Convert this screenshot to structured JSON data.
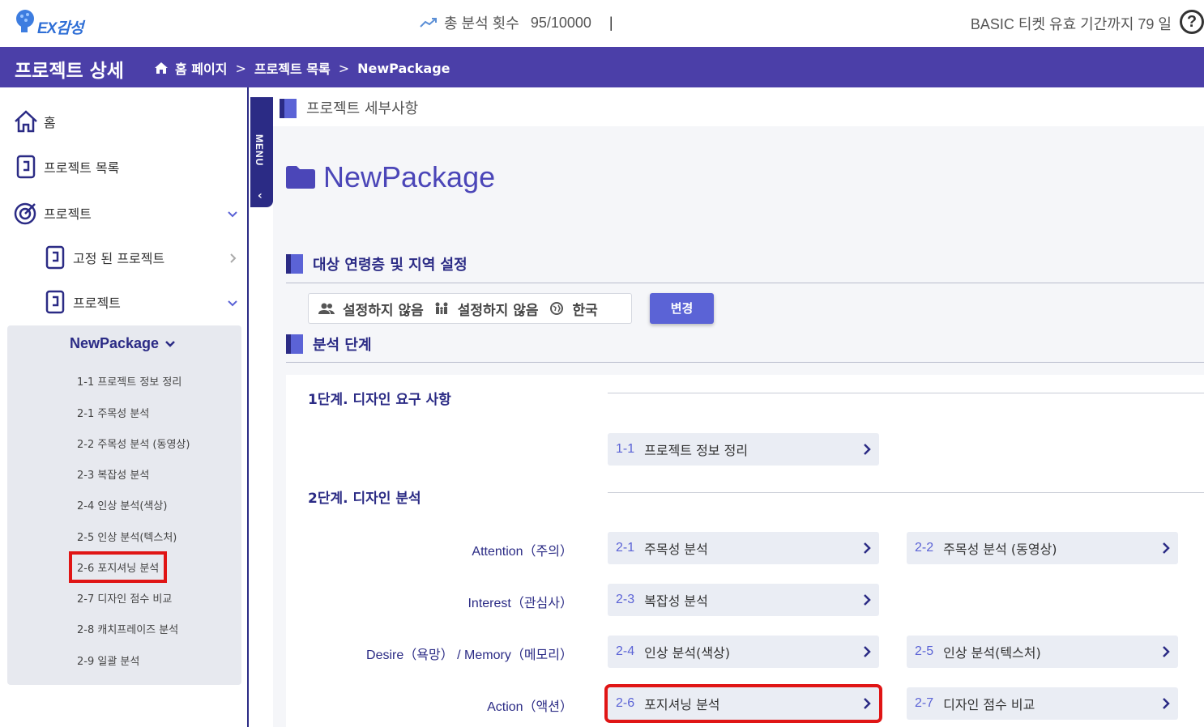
{
  "topbar": {
    "logo_text": "EX감성",
    "stats_label": "총 분석 횟수",
    "stats_value": "95/10000",
    "stats_sep": "|",
    "ticket_text": "BASIC 티켓 유효 기간까지 79 일",
    "help_label": "?"
  },
  "header": {
    "title": "프로젝트 상세",
    "breadcrumb": [
      "홈 페이지",
      "프로젝트 목록",
      "NewPackage"
    ],
    "separator": ">"
  },
  "sidebar": {
    "home": "홈",
    "project_list": "프로젝트 목록",
    "project": "프로젝트",
    "fixed_projects": "고정 된 프로젝트",
    "project_sub": "프로젝트",
    "package": "NewPackage",
    "links": [
      "1-1 프로젝트 정보 정리",
      "2-1 주목성 분석",
      "2-2 주목성 분석 (동영상)",
      "2-3 복잡성 분석",
      "2-4 인상 분석(색상)",
      "2-5 인상 분석(텍스처)",
      "2-6 포지셔닝 분석",
      "2-7 디자인 점수 비교",
      "2-8 캐치프레이즈 분석",
      "2-9 일괄 분석"
    ],
    "highlighted_link": "2-6 포지셔닝 분석"
  },
  "menu_tab": {
    "label": "MENU",
    "collapse": "‹"
  },
  "main": {
    "section_title": "프로젝트 세부사항",
    "project_name": "NewPackage",
    "target_title": "대상 연령층 및 지역 설정",
    "target": {
      "gender": "설정하지 않음",
      "age": "설정하지 않음",
      "region": "한국"
    },
    "change_button": "변경",
    "analysis_title": "분석 단계",
    "stage1_title": "1단계. 디자인 요구 사항",
    "stage2_title": "2단계. 디자인 분석",
    "rows": {
      "attention": "Attention（주의）",
      "interest": "Interest（관심사）",
      "desire": "Desire（욕망） / Memory（메모리）",
      "action": "Action（액션）"
    },
    "steps": {
      "s11": {
        "code": "1-1",
        "label": "프로젝트 정보 정리"
      },
      "s21": {
        "code": "2-1",
        "label": "주목성 분석"
      },
      "s22": {
        "code": "2-2",
        "label": "주목성 분석 (동영상)"
      },
      "s23": {
        "code": "2-3",
        "label": "복잡성 분석"
      },
      "s24": {
        "code": "2-4",
        "label": "인상 분석(색상)"
      },
      "s25": {
        "code": "2-5",
        "label": "인상 분석(텍스처)"
      },
      "s26": {
        "code": "2-6",
        "label": "포지셔닝 분석"
      },
      "s27": {
        "code": "2-7",
        "label": "디자인 점수 비교"
      }
    },
    "highlighted_step": "2-6"
  },
  "colors": {
    "header_bg": "#4b3fa8",
    "navy": "#2b2b85",
    "accent": "#5b63d6",
    "highlight": "#e01515"
  }
}
